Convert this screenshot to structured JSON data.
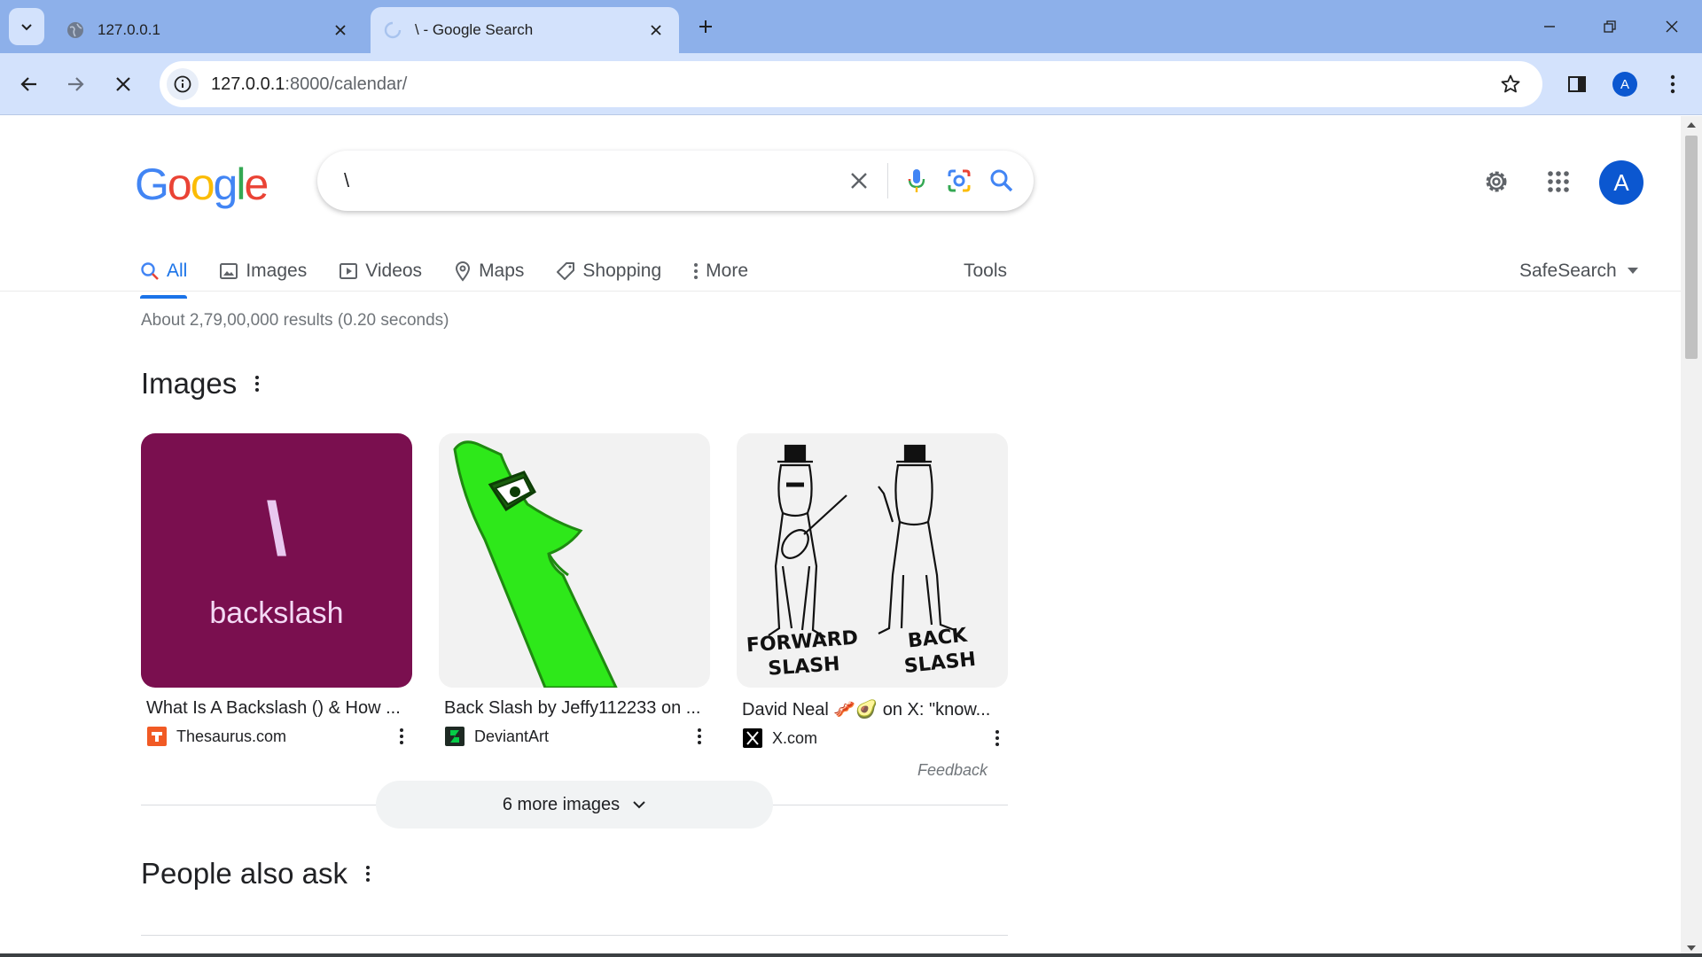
{
  "browser": {
    "tabs": [
      {
        "title": "127.0.0.1",
        "active": false
      },
      {
        "title": "\\ - Google Search",
        "active": true
      }
    ],
    "url_host": "127.0.0.1",
    "url_path": ":8000/calendar/",
    "profile_initial": "A"
  },
  "search": {
    "query": "\\",
    "logo_text": "Google",
    "avatar_initial": "A"
  },
  "nav_tabs": {
    "all": "All",
    "images": "Images",
    "videos": "Videos",
    "maps": "Maps",
    "shopping": "Shopping",
    "more": "More",
    "tools": "Tools",
    "safesearch": "SafeSearch"
  },
  "results": {
    "stats": "About 2,79,00,000 results (0.20 seconds)"
  },
  "images_section": {
    "title": "Images",
    "cards": [
      {
        "caption": "What Is A Backslash () & How ...",
        "source": "Thesaurus.com",
        "thumb_text": "backslash",
        "thumb_glyph": "\\"
      },
      {
        "caption": "Back Slash by Jeffy112233 on ...",
        "source": "DeviantArt"
      },
      {
        "caption": "David Neal 🥓🥑 on X: \"know...",
        "source": "X.com",
        "thumb_left": "FORWARD SLASH",
        "thumb_right": "BACK SLASH"
      }
    ],
    "feedback": "Feedback",
    "more_images": "6 more images"
  },
  "paa": {
    "title": "People also ask"
  },
  "colors": {
    "tabstrip": "#8db0ea",
    "toolbar": "#d3e2fc",
    "accent": "#1a73e8",
    "thesaurus_bg": "#7a0f4f",
    "green_char": "#2ee81a"
  }
}
